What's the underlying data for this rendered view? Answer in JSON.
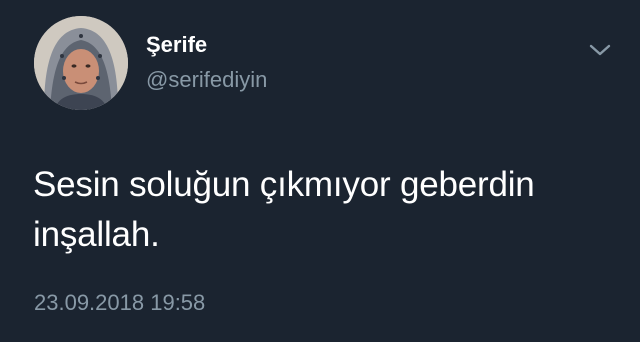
{
  "user": {
    "display_name": "Şerife",
    "handle": "@serifediyin",
    "avatar_icon": "profile-photo"
  },
  "tweet": {
    "text": "Sesin soluğun çıkmıyor geberdin inşallah.",
    "timestamp": "23.09.2018 19:58"
  },
  "menu": {
    "icon": "chevron-down-icon"
  },
  "colors": {
    "background": "#1b2430",
    "primary_text": "#ffffff",
    "secondary_text": "#8899a6"
  }
}
